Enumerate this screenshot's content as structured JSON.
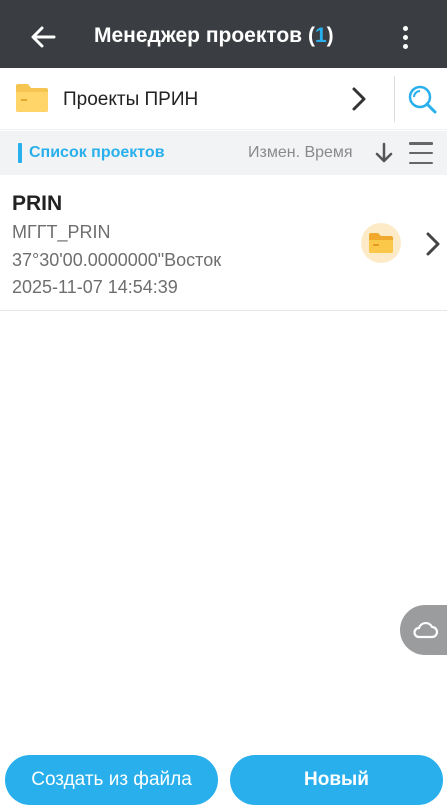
{
  "header": {
    "title": "Менеджер проектов",
    "count_open": "(",
    "count": "1",
    "count_close": ")"
  },
  "path_bar": {
    "label": "Проекты ПРИН"
  },
  "list_header": {
    "title": "Список проектов",
    "sort_label": "Измен. Время"
  },
  "projects": [
    {
      "name": "PRIN",
      "coordinate_system": "МГГТ_PRIN",
      "longitude": "37°30'00.0000000\"Восток",
      "modified": "2025-11-07 14:54:39"
    }
  ],
  "buttons": {
    "create_from_file": "Создать из файла",
    "new": "Новый"
  },
  "colors": {
    "accent": "#29b0ec",
    "header_bg": "#3a3d42",
    "folder": "#f5c451"
  },
  "icons": [
    "back-arrow-icon",
    "more-vert-icon",
    "folder-icon",
    "chevron-right-icon",
    "search-icon",
    "sort-down-icon",
    "list-menu-icon",
    "project-folder-icon",
    "cloud-icon"
  ]
}
